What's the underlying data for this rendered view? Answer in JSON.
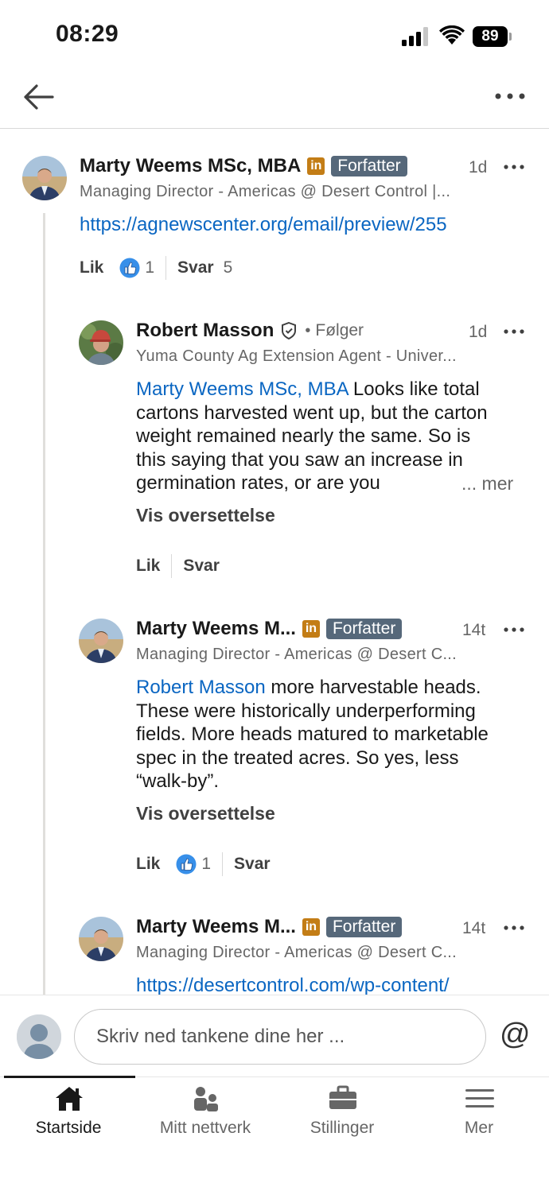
{
  "status_bar": {
    "time": "08:29",
    "battery": "89"
  },
  "comments": [
    {
      "name": "Marty Weems  MSc, MBA",
      "in_badge": "in",
      "author_badge": "Forfatter",
      "time": "1d",
      "headline": "Managing Director - Americas @ Desert Control |...",
      "link": "https://agnewscenter.org/email/preview/255",
      "like_label": "Lik",
      "like_count": "1",
      "reply_label": "Svar",
      "reply_count": "5"
    },
    {
      "name": "Robert Masson",
      "follow_dot": "•",
      "follow_label": "Følger",
      "time": "1d",
      "headline": "Yuma County Ag Extension Agent - Univer...",
      "mention": "Marty Weems  MSc, MBA",
      "text_lines": [
        " Looks like total",
        "cartons harvested went up, but the carton",
        "weight remained nearly the same. So is",
        "this saying that you saw an increase in",
        "germination rates, or are you"
      ],
      "see_more": "... mer",
      "translate": "Vis oversettelse",
      "like_label": "Lik",
      "reply_label": "Svar"
    },
    {
      "name": "Marty Weems  M...",
      "in_badge": "in",
      "author_badge": "Forfatter",
      "time": "14t",
      "headline": "Managing Director - Americas @ Desert C...",
      "mention": "Robert Masson",
      "text_lines": [
        " more harvestable heads.",
        "These were historically underperforming",
        "fields. More heads matured to marketable",
        "spec in the treated acres. So yes, less",
        "“walk-by”."
      ],
      "translate": "Vis oversettelse",
      "like_label": "Lik",
      "like_count": "1",
      "reply_label": "Svar"
    },
    {
      "name": "Marty Weems  M...",
      "in_badge": "in",
      "author_badge": "Forfatter",
      "time": "14t",
      "headline": "Managing Director - Americas @ Desert C...",
      "link": "https://desertcontrol.com/wp-content/"
    }
  ],
  "compose": {
    "placeholder": "Skriv ned tankene dine her ...",
    "at_symbol": "@"
  },
  "bottom_nav": [
    {
      "label": "Startside",
      "icon": "home-icon",
      "active": true
    },
    {
      "label": "Mitt nettverk",
      "icon": "network-icon",
      "active": false
    },
    {
      "label": "Stillinger",
      "icon": "briefcase-icon",
      "active": false
    },
    {
      "label": "Mer",
      "icon": "menu-icon",
      "active": false
    }
  ],
  "colors": {
    "link": "#0a66c2",
    "author_badge": "#56687a",
    "in_badge": "#c37d16",
    "like_icon": "#378fe9"
  }
}
